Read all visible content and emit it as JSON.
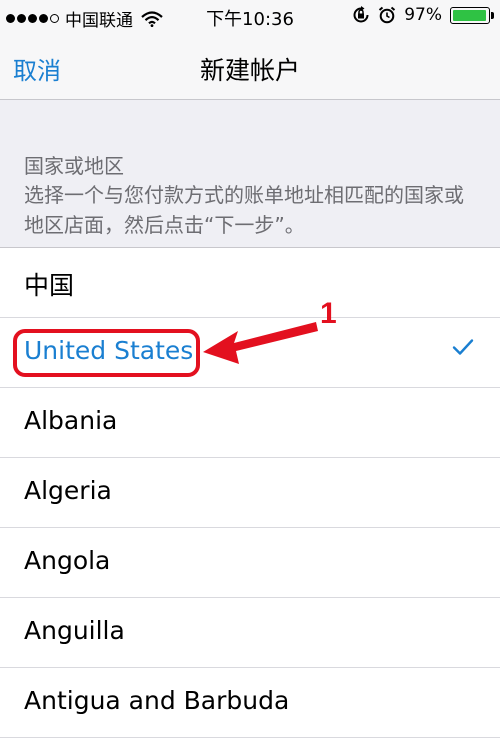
{
  "status_bar": {
    "carrier": "中国联通",
    "time": "下午10:36",
    "battery_percent": "97%",
    "battery_level": 0.97,
    "signal_bars_filled": 4,
    "icons": [
      "wifi-icon",
      "orientation-lock-icon",
      "alarm-icon",
      "battery-icon"
    ]
  },
  "nav": {
    "cancel_label": "取消",
    "title": "新建帐户"
  },
  "section": {
    "header": "国家或地区",
    "description": "选择一个与您付款方式的账单地址相匹配的国家或地区店面，然后点击“下一步”。"
  },
  "countries": [
    {
      "label": "中国",
      "selected": false
    },
    {
      "label": "United States",
      "selected": true
    },
    {
      "label": "Albania",
      "selected": false
    },
    {
      "label": "Algeria",
      "selected": false
    },
    {
      "label": "Angola",
      "selected": false
    },
    {
      "label": "Anguilla",
      "selected": false
    },
    {
      "label": "Antigua and Barbuda",
      "selected": false
    }
  ],
  "annotation": {
    "number": "1"
  },
  "colors": {
    "accent": "#1a7fd1",
    "annotation_red": "#e3101f",
    "battery_green": "#2fc244"
  }
}
